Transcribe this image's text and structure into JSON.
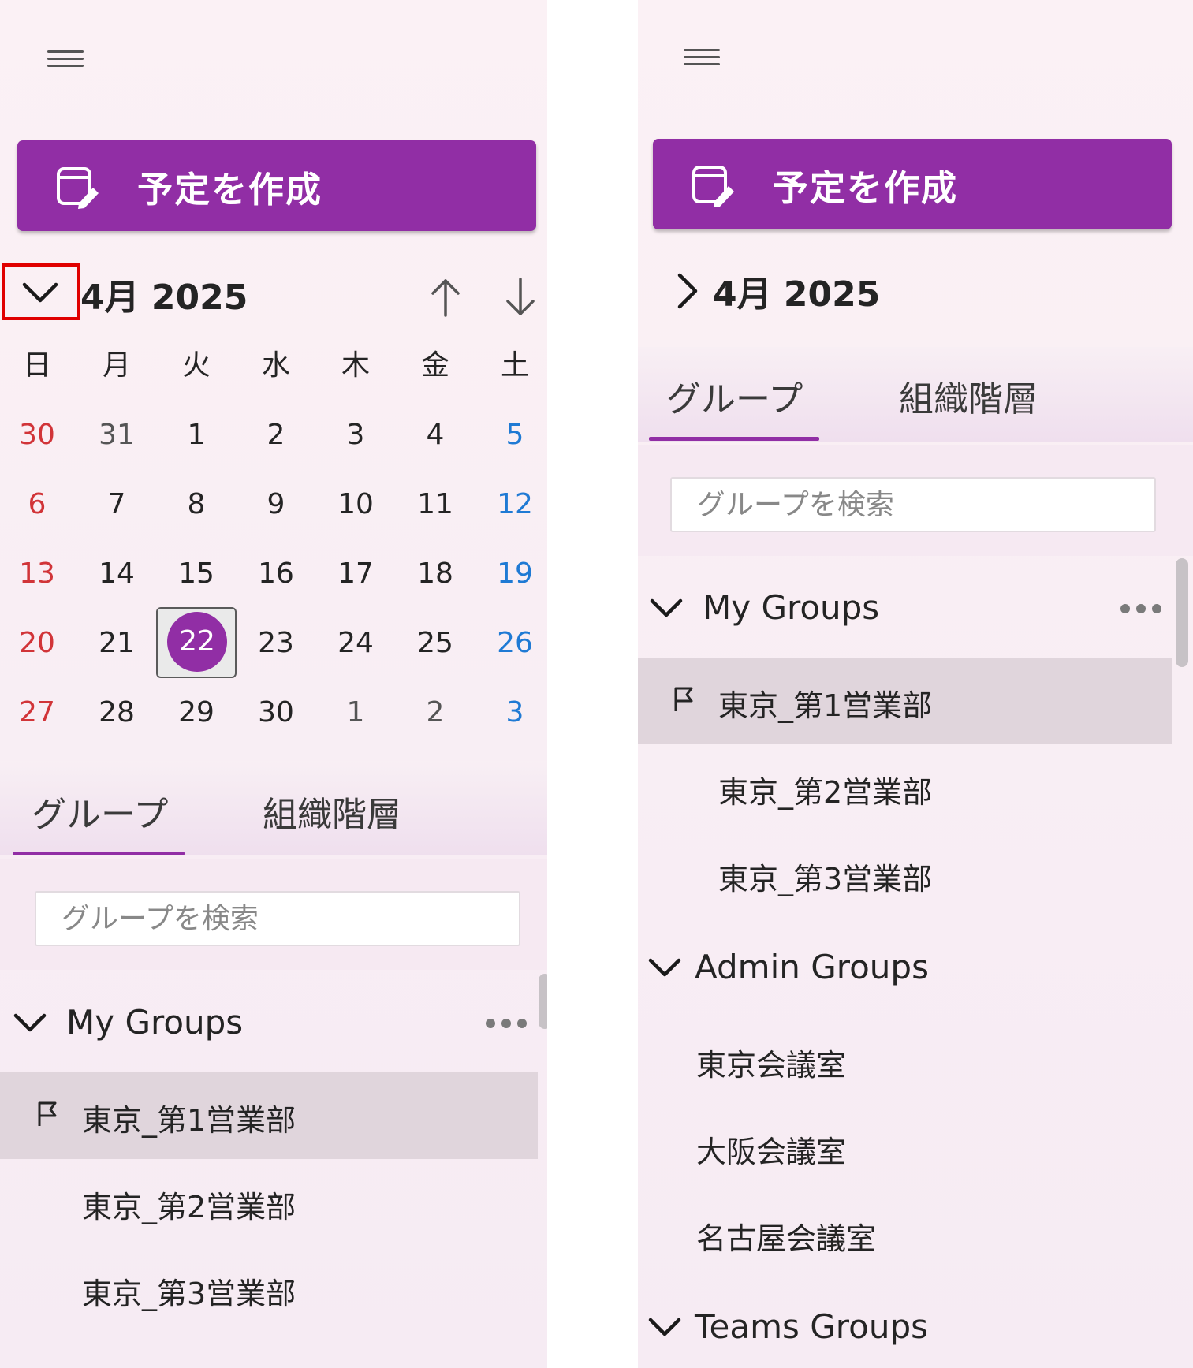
{
  "left_panel": {
    "create_button_label": "予定を作成",
    "month_title": "4月 2025",
    "weekdays": [
      "日",
      "月",
      "火",
      "水",
      "木",
      "金",
      "土"
    ],
    "weeks": [
      [
        "30",
        "31",
        "1",
        "2",
        "3",
        "4",
        "5"
      ],
      [
        "6",
        "7",
        "8",
        "9",
        "10",
        "11",
        "12"
      ],
      [
        "13",
        "14",
        "15",
        "16",
        "17",
        "18",
        "19"
      ],
      [
        "20",
        "21",
        "22",
        "23",
        "24",
        "25",
        "26"
      ],
      [
        "27",
        "28",
        "29",
        "30",
        "1",
        "2",
        "3"
      ]
    ],
    "tabs": [
      "グループ",
      "組織階層"
    ],
    "search_placeholder": "グループを検索",
    "my_groups_title": "My Groups",
    "my_groups_items": [
      "東京_第1営業部",
      "東京_第2営業部",
      "東京_第3営業部"
    ]
  },
  "right_panel": {
    "create_button_label": "予定を作成",
    "month_title": "4月 2025",
    "tabs": [
      "グループ",
      "組織階層"
    ],
    "search_placeholder": "グループを検索",
    "my_groups_title": "My Groups",
    "my_groups_items": [
      "東京_第1営業部",
      "東京_第2営業部",
      "東京_第3営業部"
    ],
    "admin_groups_title": "Admin Groups",
    "admin_groups_items": [
      "東京会議室",
      "大阪会議室",
      "名古屋会議室"
    ],
    "teams_groups_title": "Teams Groups"
  },
  "colors": {
    "accent": "#912ea5",
    "sunday": "#d13438",
    "saturday": "#1f7ad4",
    "highlight": "#e00000",
    "selected_row": "#e0d5dc"
  },
  "icons": {
    "menu": "hamburger-icon",
    "create": "calendar-edit-icon",
    "collapse": "chevron-down-icon",
    "expand": "chevron-right-icon",
    "prev": "arrow-up-icon",
    "next": "arrow-down-icon",
    "more": "more-horizontal-icon",
    "flag": "flag-icon"
  }
}
